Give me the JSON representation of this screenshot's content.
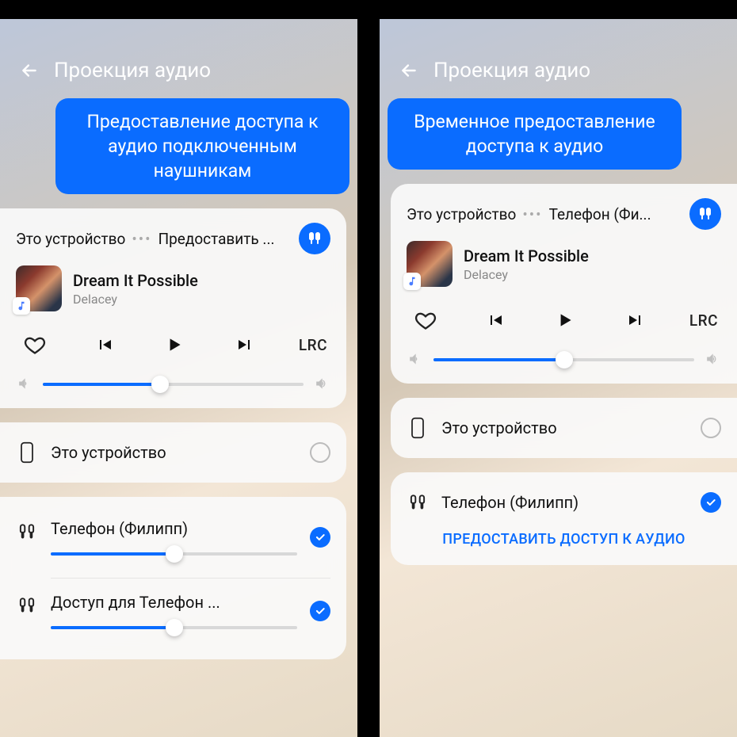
{
  "left": {
    "header_title": "Проекция аудио",
    "callout": "Предоставление доступа к аудио подключенным наушникам",
    "share_row": {
      "this_device": "Это устройство",
      "share_to": "Предоставить ..."
    },
    "track": {
      "title": "Dream It Possible",
      "artist": "Delacey"
    },
    "lrc": "LRC",
    "volume_percent": 45,
    "device_this": "Это устройство",
    "paired": [
      {
        "label": "Телефон (Филипп)",
        "volume_percent": 50
      },
      {
        "label": "Доступ для Телефон ...",
        "volume_percent": 50
      }
    ]
  },
  "right": {
    "header_title": "Проекция аудио",
    "callout": "Временное предоставление доступа к аудио",
    "share_row": {
      "this_device": "Это устройство",
      "share_to": "Телефон (Фи..."
    },
    "track": {
      "title": "Dream It Possible",
      "artist": "Delacey"
    },
    "lrc": "LRC",
    "volume_percent": 50,
    "device_this": "Это устройство",
    "paired_label": "Телефон (Филипп)",
    "share_button": "ПРЕДОСТАВИТЬ ДОСТУП К АУДИО"
  },
  "colors": {
    "accent": "#0a6cff"
  }
}
